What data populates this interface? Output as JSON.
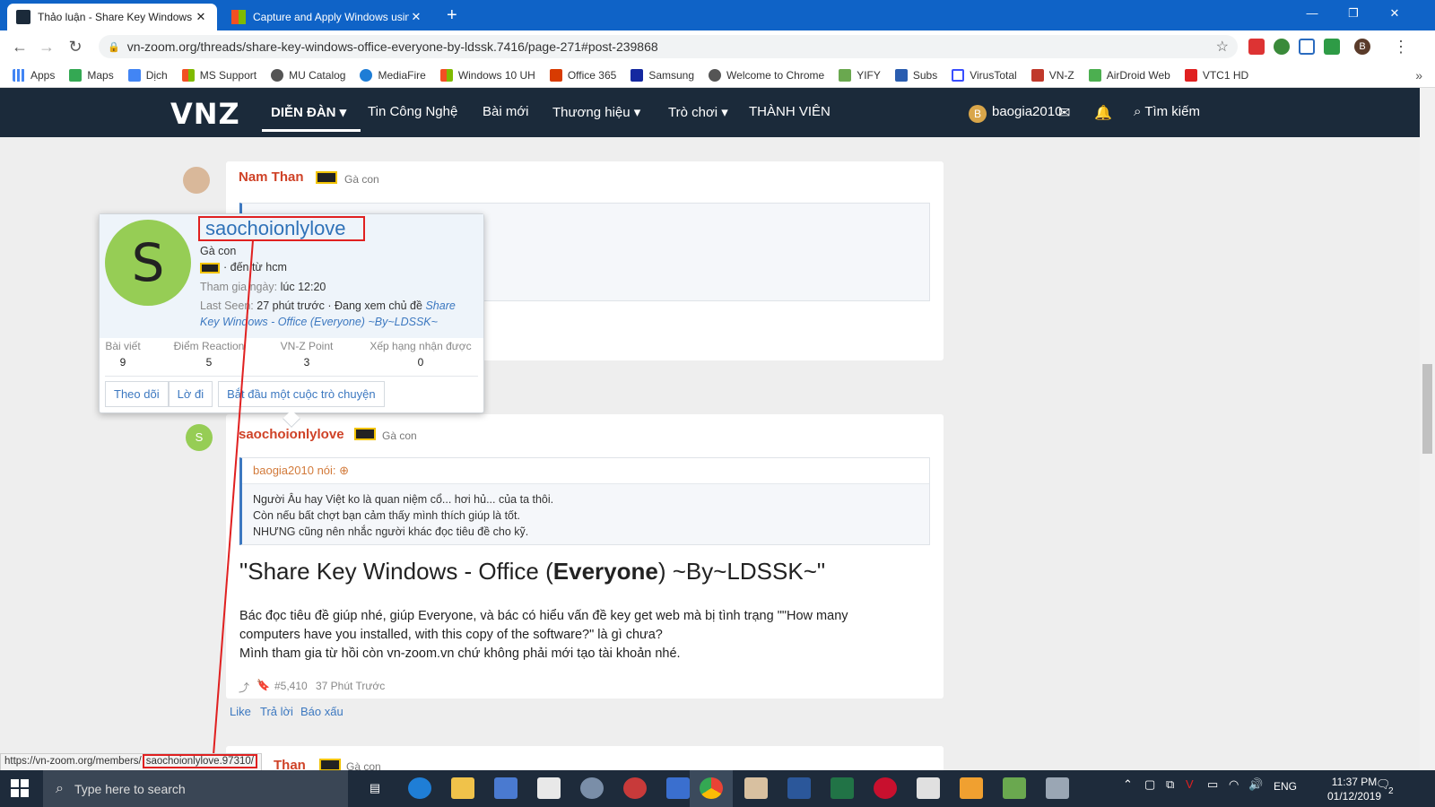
{
  "browser": {
    "tabs": [
      {
        "title": "Thảo luận - Share Key Windows",
        "active": true
      },
      {
        "title": "Capture and Apply Windows usin",
        "active": false
      }
    ],
    "new_tab": "+",
    "url": "vn-zoom.org/threads/share-key-windows-office-everyone-by-ldssk.7416/page-271#post-239868",
    "bookmarks": [
      "Apps",
      "Maps",
      "Dịch",
      "MS Support",
      "MU Catalog",
      "MediaFire",
      "Windows 10 UH",
      "Office 365",
      "Samsung",
      "Welcome to Chrome",
      "YIFY",
      "Subs",
      "VirusTotal",
      "VN-Z",
      "AirDroid Web",
      "VTC1 HD"
    ],
    "profile_initial": "B",
    "more": "»"
  },
  "site": {
    "logo": "VNZ",
    "nav": [
      "DIỄN ĐÀN",
      "Tin Công Nghệ",
      "Bài mới",
      "Thương hiệu",
      "Trò chơi",
      "THÀNH VIÊN"
    ],
    "user": "baogia2010",
    "user_initial": "B",
    "search": "Tìm kiếm"
  },
  "post1": {
    "username": "Nam Than",
    "rank": "Gà con"
  },
  "card": {
    "initial": "S",
    "username": "saochoionlylove",
    "rank": "Gà con",
    "location": "· đến từ hcm",
    "joined_label": "Tham gia ngày:",
    "joined_value": "lúc 12:20",
    "last_seen_label": "Last Seen:",
    "last_seen_value": "27 phút trước · Đang xem chủ đề",
    "last_seen_link_1": "Share",
    "last_seen_link_2": "Key Windows - Office (Everyone) ~By~LDSSK~",
    "stats": [
      {
        "label": "Bài viết",
        "value": "9"
      },
      {
        "label": "Điểm Reaction",
        "value": "5"
      },
      {
        "label": "VN-Z Point",
        "value": "3"
      },
      {
        "label": "Xếp hạng nhận được",
        "value": "0"
      }
    ],
    "buttons": [
      "Theo dõi",
      "Lờ đi",
      "Bắt đầu một cuộc trò chuyện"
    ]
  },
  "post2": {
    "initial": "S",
    "username": "saochoionlylove",
    "rank": "Gà con",
    "quote_author": "baogia2010 nói:",
    "quote_lines": [
      "Người Âu hay Việt ko là quan niệm cổ... hơi hủ... của ta thôi.",
      "Còn nếu bất chợt bạn cảm thấy mình thích giúp là tốt.",
      "NHƯNG cũng nên nhắc người khác đọc tiêu đề cho kỹ."
    ],
    "title_pre": "\"Share Key Windows - Office (",
    "title_bold": "Everyone",
    "title_post": ") ~By~LDSSK~\"",
    "body_lines": [
      "Bác đọc tiêu đề giúp nhé, giúp Everyone, và bác có hiểu vấn đề key get web mà bị tình trạng \"\"How many",
      "computers have you installed, with this copy of the software?\" là gì chưa?",
      "Mình tham gia từ hồi còn vn-zoom.vn chứ không phải mới tạo tài khoản nhé."
    ],
    "post_number": "#5,410",
    "time": "37 Phút Trước",
    "actions": [
      "Like",
      "Trả lời",
      "Báo xấu"
    ]
  },
  "post3": {
    "username_partial": "Than",
    "rank": "Gà con"
  },
  "status_bar": {
    "url_prefix": "https://vn-zoom.org/members/",
    "url_highlight": "saochoionlylove.97310/"
  },
  "taskbar": {
    "search_placeholder": "Type here to search",
    "language": "ENG",
    "time": "11:37 PM",
    "date": "01/12/2019",
    "notification_count": "2"
  },
  "colors": {
    "tabstrip": "#0f63c7",
    "site_nav": "#1b2a3a",
    "username_red": "#cf4227",
    "link_blue": "#3c78c0",
    "annotation_red": "#e02020",
    "avatar_green": "#96cd55"
  }
}
